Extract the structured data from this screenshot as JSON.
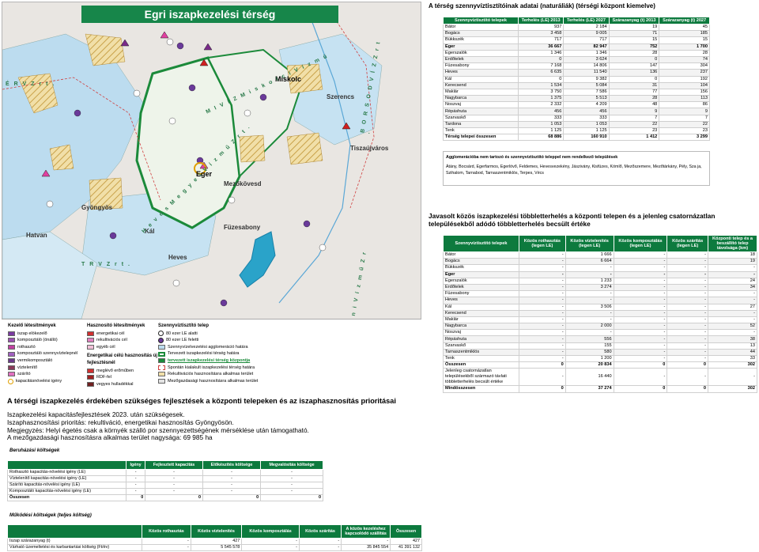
{
  "map": {
    "title": "Egri iszapkezelési térség",
    "cities": [
      "Miskolc",
      "Eger",
      "Gyöngyös",
      "Hatvan",
      "Mezőkövesd",
      "Füzesabony",
      "Heves",
      "Tiszaújváros",
      "Kál",
      "Szerencs"
    ],
    "regions": [
      "É R V  Z r t .",
      "M I V Í Z  M i s k o l c i  V í z m ű",
      "B O R S O D V Í Z  Z r t .",
      "H e v e s  M e g y e i  V í z m ű  Z r t .",
      "T R V  Z r t .",
      "D e b r e c e n i  V í z m ű  Z r t ."
    ],
    "legend": {
      "col1_title": "Kezelő létesítmények",
      "col1": [
        "iszap elökezelő",
        "komposztáló (önálló)",
        "rothasztó",
        "komposztáló szennyvíztelepnél",
        "vermikomposztáló",
        "víztelenítő",
        "szárító",
        "kapacitásnövelési igény"
      ],
      "col2_title": "Hasznosító létesítmények",
      "col2": [
        "energetikai cél",
        "rekultivációs cél",
        "egyéb cél"
      ],
      "col2b_title": "Energetikai célú hasznosítás új fejlesztésnél",
      "col2b": [
        "meglévő erőműben",
        "RDF-fel",
        "vegyes hulladékkal"
      ],
      "col3_title": "Szennyvíztisztító telep",
      "col3": [
        "80 ezer LE alatti",
        "80 ezer LE feletti",
        "Szennyvízelvezetési agglomeráció határa",
        "Tervezett iszapkezelési térség határa",
        "tervezett iszapkezelési térség központja",
        "Spontán kialakult iszapkezelési térség határa",
        "Rekultivációs hasznosításra alkalmas terület",
        "Mezőgazdasági hasznosításra alkalmas terület"
      ]
    }
  },
  "bottom": {
    "title": "A térségi iszapkezelés érdekében szükséges fejlesztések a központi telepeken és az iszaphasznosítás prioritásai",
    "lines": [
      "Iszapkezelési kapacitásfejlesztések 2023. után szükségesek.",
      "Iszaphasznosítási prioritás: rekultiváció, energetikai hasznosítás Gyöngyösön.",
      "Megjegyzés: Helyi égetés csak a környék szálló por szennyezettségének mérséklése után támogatható.",
      "A mezőgazdasági hasznosításra alkalmas terület nagysága: 69 985 ha"
    ]
  },
  "table1": {
    "title": "A térség szennyvíztisztítóinak adatai (naturáliák) (térségi központ kiemelve)",
    "headers": [
      "Szennyvíztisztító telepek",
      "Terhelés (LE) 2013",
      "Terhelés (LE) 2027",
      "Szárazanyag (t) 2013",
      "Szárazanyag (t) 2027"
    ],
    "rows": [
      [
        "Bátor",
        "937",
        "2 184",
        "19",
        "45"
      ],
      [
        "Bogács",
        "3 458",
        "9 005",
        "71",
        "185"
      ],
      [
        "Bükkszék",
        "717",
        "717",
        "15",
        "15"
      ],
      [
        "Eger",
        "36 667",
        "82 947",
        "752",
        "1 700"
      ],
      [
        "Egerszalók",
        "1 346",
        "1 346",
        "28",
        "28"
      ],
      [
        "Erdőtelek",
        "0",
        "3 624",
        "0",
        "74"
      ],
      [
        "Füzesabony",
        "7 168",
        "14 806",
        "147",
        "304"
      ],
      [
        "Heves",
        "6 635",
        "11 540",
        "136",
        "237"
      ],
      [
        "Kál",
        "0",
        "9 382",
        "0",
        "192"
      ],
      [
        "Kerecsend",
        "1 534",
        "5 084",
        "31",
        "104"
      ],
      [
        "Maklár",
        "3 750",
        "7 586",
        "77",
        "156"
      ],
      [
        "Nagybarca",
        "1 375",
        "5 513",
        "28",
        "113"
      ],
      [
        "Noszvaj",
        "2 332",
        "4 209",
        "48",
        "86"
      ],
      [
        "Répáshuta",
        "456",
        "456",
        "9",
        "9"
      ],
      [
        "Szarvaskő",
        "333",
        "333",
        "7",
        "7"
      ],
      [
        "Tardona",
        "1 053",
        "1 053",
        "22",
        "22"
      ],
      [
        "Tenk",
        "1 125",
        "1 125",
        "23",
        "23"
      ]
    ],
    "total": [
      "Térség telepei összesen",
      "68 886",
      "160 910",
      "1 412",
      "3 299"
    ]
  },
  "aggl_box": {
    "title": "Agglomerációba nem tartozó és szennyvíztisztító teleppel nem rendelkező települések",
    "text": "Átány, Bocsárd, Egerfarmos, Egerlövő, Feldemes, Hevesvezekény, Jászivány, Kisfüzes, Kömlő, Mezőszemere, Mezőtárkány, Pély, Sza  ja, Szihalom, Tarnabod, Tarnaszentmiklós, Terpes, Vécs"
  },
  "table2": {
    "title": "Javasolt közös iszapkezelési többletterhelés a központi telepen és a jelenleg csatornázatlan településekből adódó többletterhelés becsült értéke",
    "headers": [
      "Szennyvíztisztító telepek",
      "Közös rothasztás (legen LE)",
      "Közös víztelenítés (legen LE)",
      "Közös komposztálás (legen LE)",
      "Közös szárítás (legen LE)",
      "Központi telep és a beszállító telep távolsága (km)"
    ],
    "rows": [
      [
        "Bátor",
        "-",
        "1 666",
        "-",
        "-",
        "18"
      ],
      [
        "Bogács",
        "-",
        "6 664",
        "-",
        "-",
        "19"
      ],
      [
        "Bükkszék",
        "-",
        "-",
        "-",
        "-",
        "-"
      ],
      [
        "Eger",
        "-",
        "-",
        "-",
        "-",
        "-"
      ],
      [
        "Egerszalók",
        "-",
        "1 233",
        "-",
        "-",
        "24"
      ],
      [
        "Erdőtelek",
        "-",
        "3 274",
        "-",
        "-",
        "34"
      ],
      [
        "Füzesabony",
        "-",
        "-",
        "-",
        "-",
        "-"
      ],
      [
        "Heves",
        "-",
        "-",
        "-",
        "-",
        "-"
      ],
      [
        "Kál",
        "-",
        "3 506",
        "-",
        "-",
        "27"
      ],
      [
        "Kerecsend",
        "-",
        "-",
        "-",
        "-",
        "-"
      ],
      [
        "Maklár",
        "-",
        "-",
        "-",
        "-",
        "-"
      ],
      [
        "Nagybarca",
        "-",
        "2 000",
        "-",
        "-",
        "52"
      ],
      [
        "Noszvaj",
        "-",
        "-",
        "-",
        "-",
        "-"
      ],
      [
        "Répáshuta",
        "-",
        "556",
        "-",
        "-",
        "38"
      ],
      [
        "Szarvaskő",
        "-",
        "155",
        "-",
        "-",
        "13"
      ],
      [
        "Tarnaszentmiklós",
        "-",
        "580",
        "-",
        "-",
        "44"
      ],
      [
        "Tenk",
        "-",
        "1 200",
        "-",
        "-",
        "33"
      ]
    ],
    "total": [
      "Összesen",
      "0",
      "20 834",
      "0",
      "0",
      "302"
    ],
    "extra": [
      "Jelenleg csatornázatlan településekből származó távlati többletterhelés becsült értéke",
      "-",
      "16 440",
      "-",
      "-",
      "-"
    ],
    "grand": [
      "Mindösszesen",
      "0",
      "37 274",
      "0",
      "0",
      "302"
    ]
  },
  "beruh": {
    "title": "Beruházási költségek",
    "headers": [
      "",
      "Igény",
      "Fejlesztett kapacitás",
      "Előkészítés költsége",
      "Megvalósítás költsége"
    ],
    "rows": [
      [
        "Rothasztó kapacitás-növelési igény (LE)",
        "-",
        "-",
        "-",
        "-"
      ],
      [
        "Víztelenítő kapacitás-növelési igény (LE)",
        "-",
        "-",
        "-",
        "-"
      ],
      [
        "Szárító kapacitás-növelési igény (LE)",
        "-",
        "-",
        "-",
        "-"
      ],
      [
        "Komposztáló kapacitás-növelési igény (LE)",
        "-",
        "-",
        "-",
        "-"
      ]
    ],
    "total": [
      "Összesen",
      "0",
      "0",
      "0",
      "0"
    ]
  },
  "mukod": {
    "title": "Működési költségek (teljes költség)",
    "headers": [
      "",
      "Közös rothasztás",
      "Közös víztelenítés",
      "Közös komposztálás",
      "Közös szárítás",
      "A közös kezeléshez kapcsolódó szállítás",
      "Összesen"
    ],
    "rows": [
      [
        "Iszap szárazanyag (t)",
        "-",
        "427",
        "-",
        "-",
        "-",
        "427"
      ],
      [
        "Várható üzemeltetési és karbantartási költség (Ft/év)",
        "-",
        "5 545 578",
        "-",
        "-",
        "35 845 554",
        "41 391 132"
      ]
    ]
  },
  "colors": {
    "green": "#0d7a3e",
    "map_blue": "#a9d2ea",
    "hatch": "#e3c47a"
  }
}
